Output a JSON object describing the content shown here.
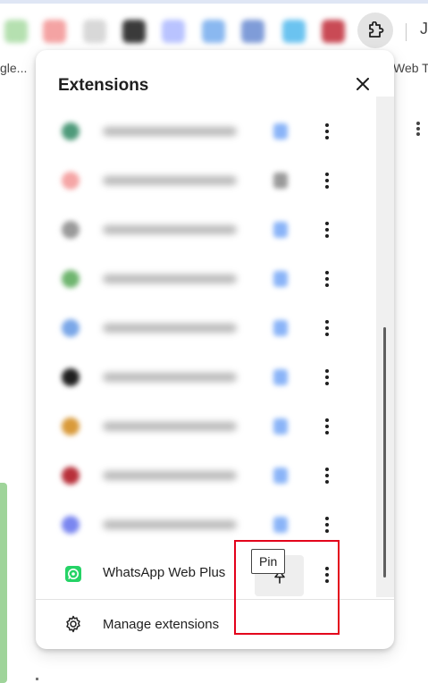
{
  "toolbar": {
    "icon_colors": [
      "#b5e0b0",
      "#f4a3a3",
      "#d8d8d8",
      "#3a3a3a",
      "#b9c3ff",
      "#8ab8f0",
      "#7f9cd8",
      "#6bc3f0",
      "#c94a55"
    ],
    "bookmark_left": "gle...",
    "bookmark_right": "Web To"
  },
  "popup": {
    "title": "Extensions",
    "close_icon": "close-icon",
    "extensions": [
      {
        "icon_color": "#4e9a7a",
        "pin_state": "pinned"
      },
      {
        "icon_color": "#f5a5a5",
        "pin_state": "unpinned"
      },
      {
        "icon_color": "#9a9a9a",
        "pin_state": "pinned"
      },
      {
        "icon_color": "#6fb56f",
        "pin_state": "pinned"
      },
      {
        "icon_color": "#7aa7e8",
        "pin_state": "pinned"
      },
      {
        "icon_color": "#1f1f1f",
        "pin_state": "pinned"
      },
      {
        "icon_color": "#d99a3a",
        "pin_state": "pinned"
      },
      {
        "icon_color": "#b8303a",
        "pin_state": "pinned"
      },
      {
        "icon_color": "#7a86f0",
        "pin_state": "pinned"
      }
    ],
    "whatsapp": {
      "name": "WhatsApp Web Plus",
      "icon_color": "#25d366",
      "pin_tooltip": "Pin"
    },
    "manage_label": "Manage extensions"
  },
  "colors": {
    "highlight": "#e3001b"
  }
}
